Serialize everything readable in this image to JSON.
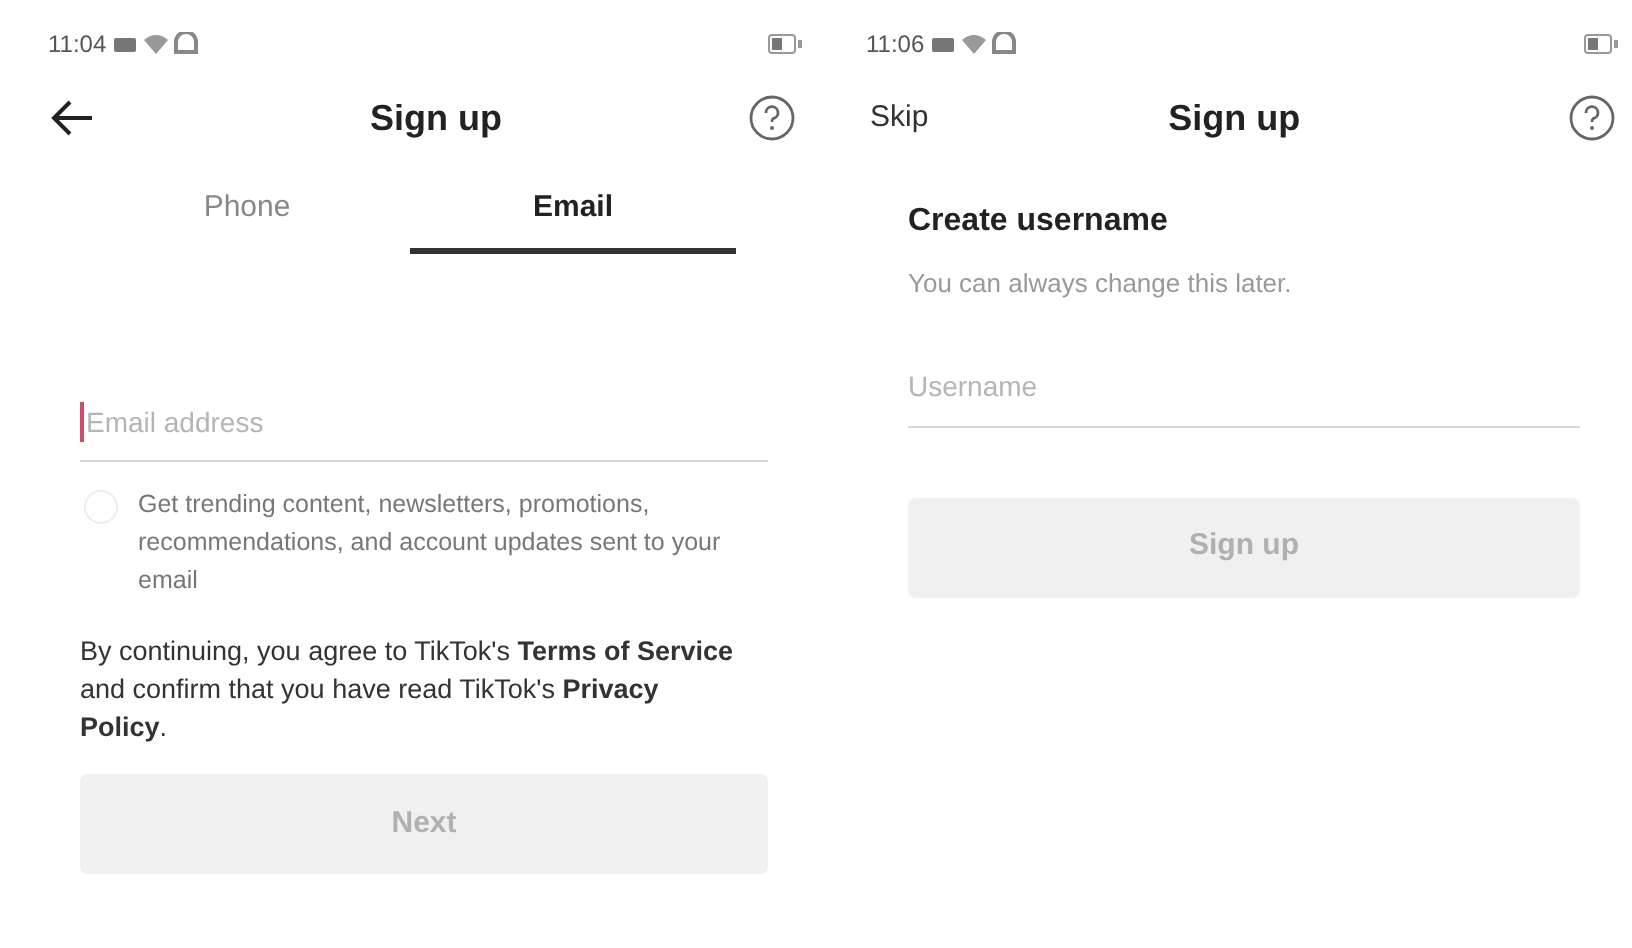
{
  "email_screen": {
    "status_bar": {
      "time": "11:04"
    },
    "header": {
      "title": "Sign up"
    },
    "tabs": [
      {
        "label": "Phone",
        "selected": false
      },
      {
        "label": "Email",
        "selected": true
      }
    ],
    "email_field": {
      "placeholder": "Email address",
      "focused": true
    },
    "newsletter_option": {
      "label": "Get trending content, newsletters, promotions, recommendations, and account updates sent to your email",
      "checked": false
    },
    "legal_text": "By continuing, you agree to TikTok's  **Terms of Service**  and confirm that you have read TikTok's **Privacy Policy**.",
    "next_button": {
      "label": "Next",
      "disabled": true
    }
  },
  "username_screen": {
    "status_bar": {
      "time": "11:06"
    },
    "header": {
      "skip": "Skip",
      "title": "Sign up"
    },
    "heading": "Create username",
    "subtitle": "You can always change this later.",
    "username_field": {
      "placeholder": "Username",
      "focused": false
    },
    "signup_button": {
      "label": "Sign up",
      "disabled": true
    }
  }
}
